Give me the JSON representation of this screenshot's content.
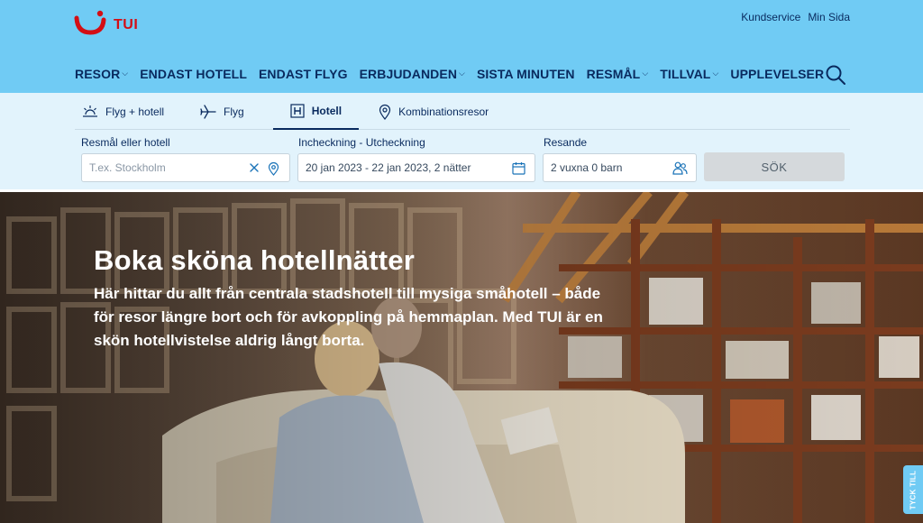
{
  "brand": {
    "name": "TUI",
    "color": "#d40e14",
    "header_bg": "#70cbf4"
  },
  "util_links": [
    "Kundservice",
    "Min Sida"
  ],
  "nav": [
    {
      "label": "RESOR",
      "dropdown": true
    },
    {
      "label": "ENDAST HOTELL",
      "dropdown": false
    },
    {
      "label": "ENDAST FLYG",
      "dropdown": false
    },
    {
      "label": "ERBJUDANDEN",
      "dropdown": true
    },
    {
      "label": "SISTA MINUTEN",
      "dropdown": false
    },
    {
      "label": "RESMÅL",
      "dropdown": true
    },
    {
      "label": "TILLVAL",
      "dropdown": true
    },
    {
      "label": "UPPLEVELSER",
      "dropdown": false
    }
  ],
  "tabs": [
    {
      "label": "Flyg + hotell",
      "icon": "sun-icon"
    },
    {
      "label": "Flyg",
      "icon": "plane-icon"
    },
    {
      "label": "Hotell",
      "icon": "hotel-icon",
      "active": true
    },
    {
      "label": "Kombinationsresor",
      "icon": "location-pin-icon"
    }
  ],
  "search": {
    "destination_label": "Resmål eller hotell",
    "destination_placeholder": "T.ex. Stockholm",
    "dates_label": "Incheckning - Utcheckning",
    "dates_value": "20 jan 2023 - 22 jan 2023, 2 nätter",
    "travelers_label": "Resande",
    "travelers_value": "2 vuxna 0 barn",
    "submit_label": "SÖK"
  },
  "hero": {
    "title": "Boka sköna hotellnätter",
    "text": "Här hittar du allt från centrala stadshotell till mysiga småhotell – både för resor längre bort och för avkoppling på hemmaplan. Med TUI är en skön hotellvistelse aldrig långt borta."
  },
  "feedback": {
    "label": "TYCK TILL"
  }
}
